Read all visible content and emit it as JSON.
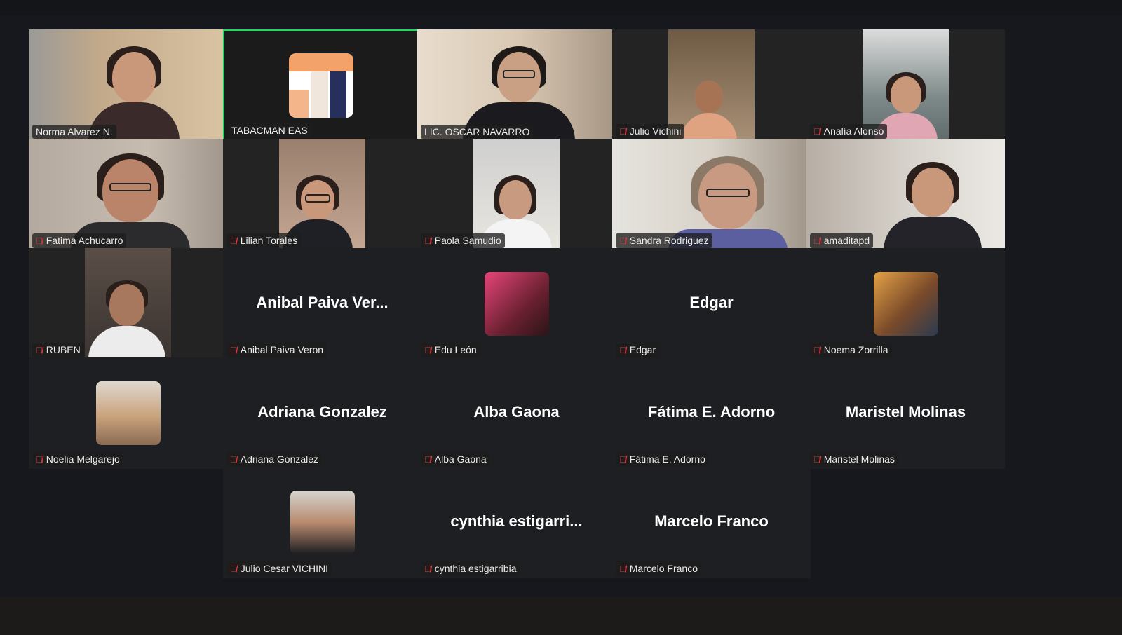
{
  "meeting": {
    "participants": [
      {
        "display": "Norma Alvarez N.",
        "muted": false,
        "mode": "video",
        "speaking": false
      },
      {
        "display": "TABACMAN EAS",
        "muted": false,
        "mode": "logo",
        "speaking": true
      },
      {
        "display": "LIC. OSCAR NAVARRO",
        "muted": false,
        "mode": "video",
        "speaking": false
      },
      {
        "display": "Julio Vichini",
        "muted": true,
        "mode": "video",
        "speaking": false
      },
      {
        "display": "Analía Alonso",
        "muted": true,
        "mode": "video",
        "speaking": false
      },
      {
        "display": "Fatima Achucarro",
        "muted": true,
        "mode": "video",
        "speaking": false
      },
      {
        "display": "Lilian Torales",
        "muted": true,
        "mode": "video",
        "speaking": false
      },
      {
        "display": "Paola Samudio",
        "muted": true,
        "mode": "video",
        "speaking": false
      },
      {
        "display": "Sandra Rodriguez",
        "muted": true,
        "mode": "video",
        "speaking": false
      },
      {
        "display": "amaditapd",
        "muted": true,
        "mode": "video",
        "speaking": false
      },
      {
        "display": "RUBEN",
        "muted": true,
        "mode": "video",
        "speaking": false
      },
      {
        "display": "Anibal Paiva Veron",
        "big": "Anibal  Paiva  Ver...",
        "muted": true,
        "mode": "name",
        "speaking": false
      },
      {
        "display": "Edu León",
        "muted": true,
        "mode": "avatar",
        "speaking": false
      },
      {
        "display": "Edgar",
        "big": "Edgar",
        "muted": true,
        "mode": "name",
        "speaking": false
      },
      {
        "display": "Noema Zorrilla",
        "muted": true,
        "mode": "avatar",
        "speaking": false
      },
      {
        "display": "Noelia Melgarejo",
        "muted": true,
        "mode": "avatar",
        "speaking": false
      },
      {
        "display": "Adriana Gonzalez",
        "big": "Adriana Gonzalez",
        "muted": true,
        "mode": "name",
        "speaking": false
      },
      {
        "display": "Alba Gaona",
        "big": "Alba Gaona",
        "muted": true,
        "mode": "name",
        "speaking": false
      },
      {
        "display": "Fátima E. Adorno",
        "big": "Fátima E. Adorno",
        "muted": true,
        "mode": "name",
        "speaking": false
      },
      {
        "display": "Maristel Molinas",
        "big": "Maristel Molinas",
        "muted": true,
        "mode": "name",
        "speaking": false
      },
      {
        "display": "Julio Cesar VICHINI",
        "muted": true,
        "mode": "avatar",
        "speaking": false
      },
      {
        "display": "cynthia estigarribia",
        "big": "cynthia  estigarri...",
        "muted": true,
        "mode": "name",
        "speaking": false
      },
      {
        "display": "Marcelo Franco",
        "big": "Marcelo Franco",
        "muted": true,
        "mode": "name",
        "speaking": false
      }
    ],
    "muted_icon": "mic-muted-icon",
    "colors": {
      "background": "#16181d",
      "tile": "#232323",
      "speaking_border": "#1fd86a",
      "muted_icon": "#e0353a"
    }
  }
}
